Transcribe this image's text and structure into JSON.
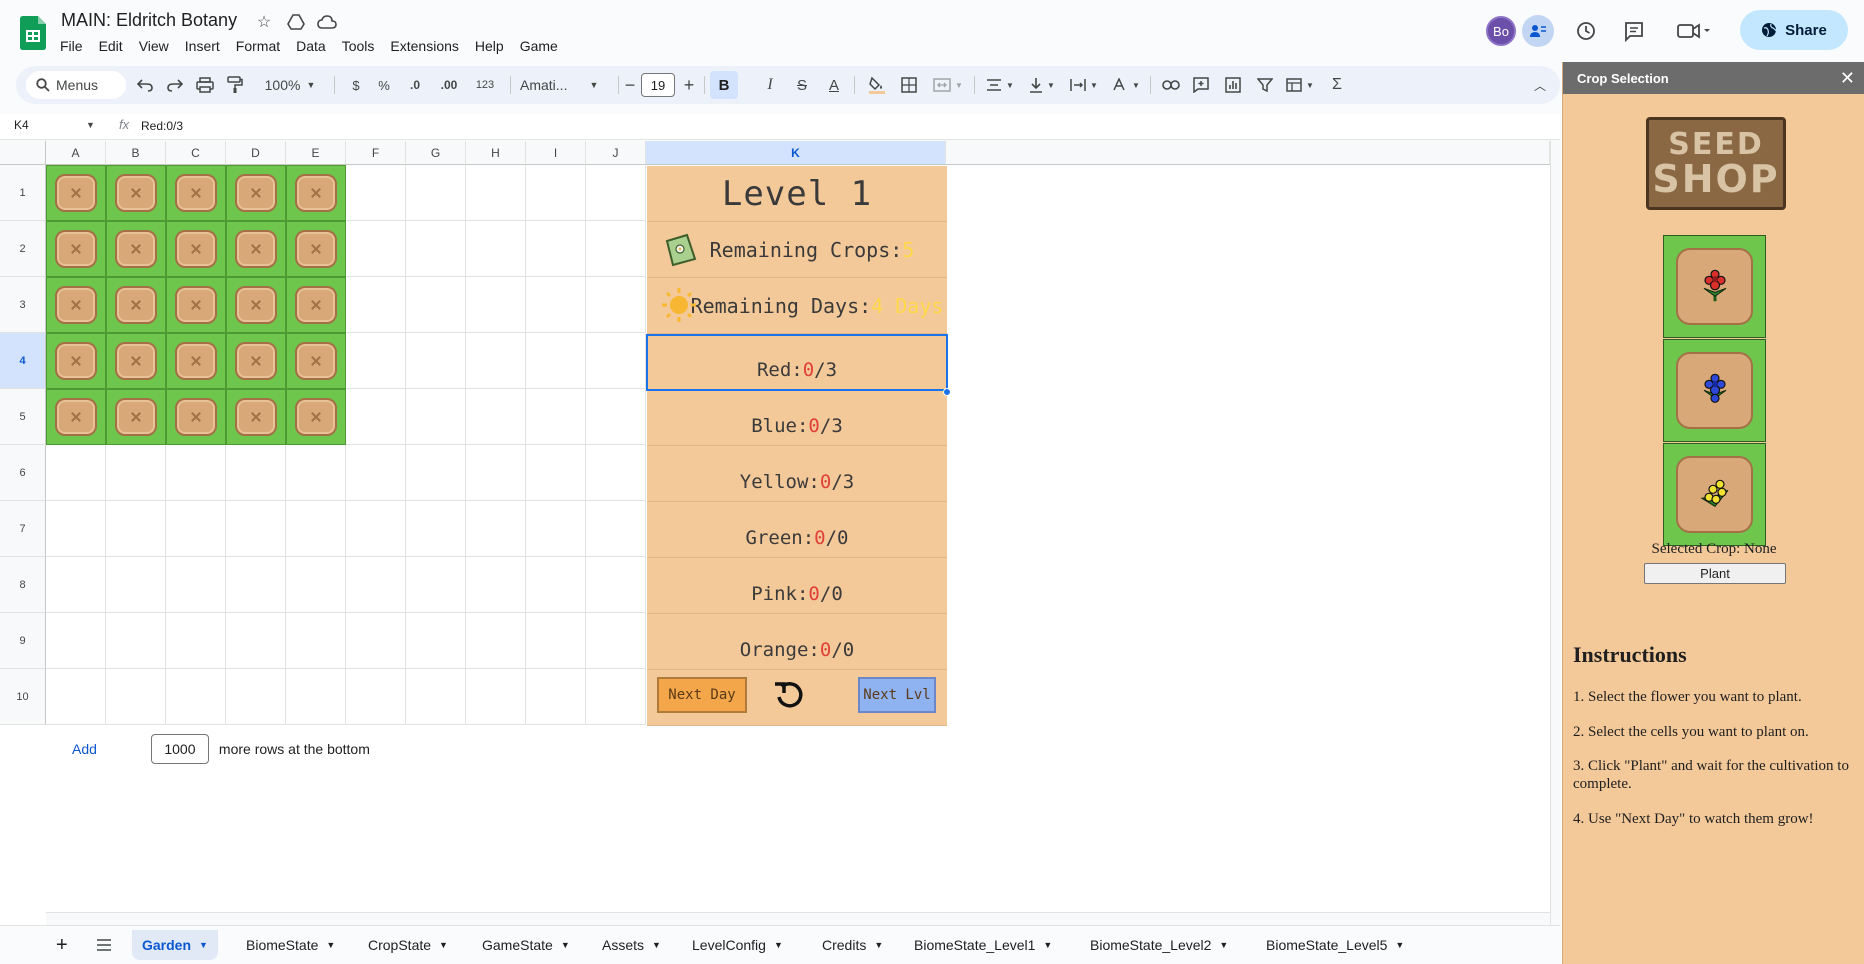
{
  "title_bar": {
    "doc_title": "MAIN: Eldritch Botany",
    "avatar_initials": "Bo",
    "share_label": "Share"
  },
  "menu": [
    "File",
    "Edit",
    "View",
    "Insert",
    "Format",
    "Data",
    "Tools",
    "Extensions",
    "Help",
    "Game"
  ],
  "toolbar": {
    "search_label": "Menus",
    "zoom": "100%",
    "currency": "$",
    "percent": "%",
    "dec_less": ".0",
    "dec_more": ".00",
    "number_format": "123",
    "font": "Amati...",
    "font_size": "19",
    "bold": "B",
    "italic": "I",
    "strike": "S",
    "text_color": "A",
    "sigma": "Σ"
  },
  "formula_bar": {
    "cell_ref": "K4",
    "fx": "fx",
    "content": "Red:0/3"
  },
  "columns": [
    "A",
    "B",
    "C",
    "D",
    "E",
    "F",
    "G",
    "H",
    "I",
    "J",
    "K"
  ],
  "rows": [
    "1",
    "2",
    "3",
    "4",
    "5",
    "6",
    "7",
    "8",
    "9",
    "10"
  ],
  "selected_column": "K",
  "selected_row": "4",
  "game_panel": {
    "level": "Level 1",
    "remaining_crops_label": "Remaining Crops:",
    "remaining_crops_value": "5",
    "remaining_days_label": "Remaining Days:",
    "remaining_days_value": "4 Days",
    "red_label": "Red:",
    "red_value": "0",
    "red_total": "/3",
    "blue_label": "Blue: ",
    "blue_value": "0",
    "blue_total": "/3",
    "yellow_label": "Yellow: ",
    "yellow_value": "0",
    "yellow_total": "/3",
    "green_label": "Green: ",
    "green_value": "0",
    "green_total": "/0",
    "pink_label": "Pink: ",
    "pink_value": "0",
    "pink_total": "/0",
    "orange_label": "Orange: ",
    "orange_value": "0",
    "orange_total": "/0",
    "next_day_label": "Next Day",
    "next_lvl_label": "Next Lvl"
  },
  "add_rows": {
    "add_label": "Add",
    "count": "1000",
    "suffix": "more rows at the bottom"
  },
  "sheet_tabs": [
    "Garden",
    "BiomeState",
    "CropState",
    "GameState",
    "Assets",
    "LevelConfig",
    "Credits",
    "BiomeState_Level1",
    "BiomeState_Level2",
    "BiomeState_Level5"
  ],
  "active_tab": "Garden",
  "side_panel": {
    "header": "Crop Selection",
    "sign_line1": "SEED",
    "sign_line2": "SHOP",
    "selected_crop": "Selected Crop: None",
    "plant_button": "Plant",
    "instructions_title": "Instructions",
    "instructions": [
      "1. Select the flower you want to plant.",
      "2. Select the cells you want to plant on.",
      "3. Click \"Plant\" and wait for the cultivation to complete.",
      "4. Use \"Next Day\" to watch them grow!"
    ]
  },
  "colors": {
    "panel_bg": "#f4c999",
    "accent_blue": "#1a73e8",
    "red_count": "#e0413a",
    "yellow_count": "#ffd84a",
    "grass": "#6ec64d",
    "soil": "#d8a878"
  },
  "icons": [
    "sheets-logo",
    "star-icon",
    "move-to-drive-icon",
    "cloud-status-icon",
    "history-icon",
    "comment-icon",
    "meet-icon",
    "globe-icon",
    "undo-icon",
    "redo-icon",
    "print-icon",
    "paint-format-icon",
    "seed-bag-icon",
    "sun-icon",
    "refresh-icon",
    "close-icon"
  ]
}
